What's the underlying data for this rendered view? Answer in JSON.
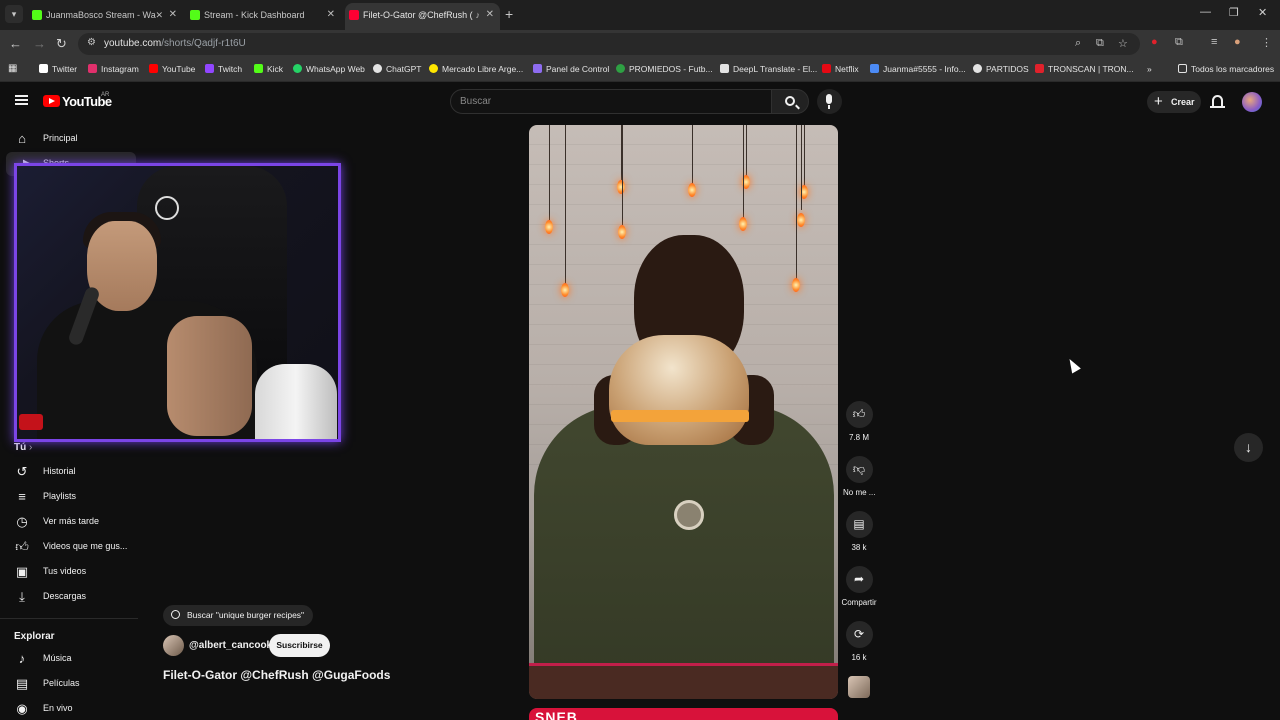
{
  "browser": {
    "tabs": [
      {
        "title": "JuanmaBosco Stream - Wa",
        "favicon_color": "#53fc18"
      },
      {
        "title": "Stream - Kick Dashboard",
        "favicon_color": "#53fc18"
      },
      {
        "title": "Filet-O-Gator @ChefRush (",
        "favicon_color": "#ff0033"
      }
    ],
    "url_host": "youtube.com",
    "url_path": "/shorts/Qadjf-r1t6U",
    "bookmarks": [
      {
        "label": "Twitter",
        "icon": "x-icon",
        "color": "#ffffff"
      },
      {
        "label": "Instagram",
        "icon": "instagram-icon",
        "color": "#e1306c"
      },
      {
        "label": "YouTube",
        "icon": "youtube-icon",
        "color": "#ff0000"
      },
      {
        "label": "Twitch",
        "icon": "twitch-icon",
        "color": "#9146ff"
      },
      {
        "label": "Kick",
        "icon": "kick-icon",
        "color": "#53fc18"
      },
      {
        "label": "WhatsApp Web",
        "icon": "whatsapp-icon",
        "color": "#25d366"
      },
      {
        "label": "ChatGPT",
        "icon": "chatgpt-icon",
        "color": "#e3e3e3"
      },
      {
        "label": "Mercado Libre Arge...",
        "icon": "mercadolibre-icon",
        "color": "#ffe600"
      },
      {
        "label": "Panel de Control",
        "icon": "panel-icon",
        "color": "#8e6cf0"
      },
      {
        "label": "PROMIEDOS - Futb...",
        "icon": "promiedos-icon",
        "color": "#2ea043"
      },
      {
        "label": "DeepL Translate - El...",
        "icon": "deepl-icon",
        "color": "#e3e3e3"
      },
      {
        "label": "Netflix",
        "icon": "netflix-icon",
        "color": "#e50914"
      },
      {
        "label": "Juanma#5555 - Info...",
        "icon": "info-icon",
        "color": "#4c8bf5"
      },
      {
        "label": "PARTIDOS",
        "icon": "partidos-icon",
        "color": "#e3e3e3"
      },
      {
        "label": "TRONSCAN | TRON...",
        "icon": "tronscan-icon",
        "color": "#e0212b"
      }
    ],
    "bookmarks_overflow": "»",
    "all_bookmarks": "Todos los marcadores"
  },
  "youtube": {
    "logo_text": "YouTube",
    "country": "AR",
    "search_placeholder": "Buscar",
    "create_label": "Crear",
    "sidebar": {
      "home": "Principal",
      "shorts_partial": "Shorts",
      "you_header": "Tú",
      "you_items": [
        "Historial",
        "Playlists",
        "Ver más tarde",
        "Videos que me gus...",
        "Tus videos",
        "Descargas"
      ],
      "explore_header": "Explorar",
      "explore_items": [
        "Música",
        "Películas",
        "En vivo"
      ]
    },
    "short": {
      "search_suggestion": "Buscar \"unique burger recipes\"",
      "channel": "@albert_cancook",
      "subscribe": "Suscribirse",
      "title": "Filet-O-Gator @ChefRush @GugaFoods",
      "likes": "7.8 M",
      "dislike": "No me ...",
      "comments": "38 k",
      "share": "Compartir",
      "remix": "16 k",
      "next_banner_text": "SNEB"
    },
    "accent_color": "#ff0000",
    "webcam_border_color": "#7b45e6"
  }
}
